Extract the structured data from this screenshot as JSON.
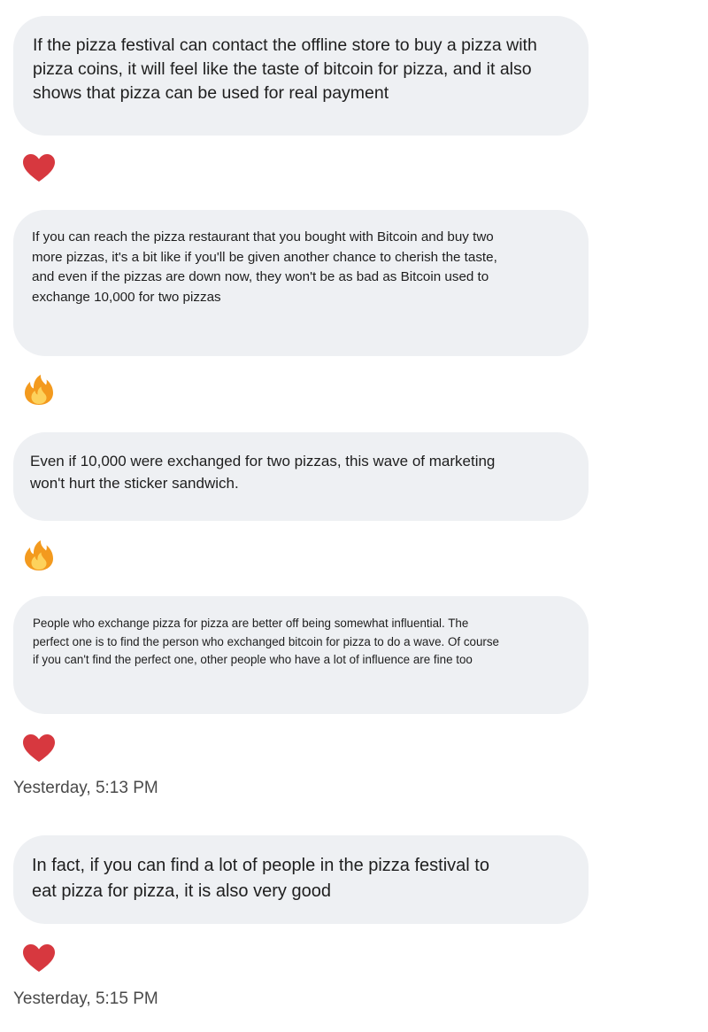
{
  "messages": [
    {
      "text": "If the pizza festival can contact the offline store to buy a pizza with\npizza coins, it will feel like the taste of bitcoin for pizza, and it also\nshows that pizza can be used for real payment",
      "reaction": "heart-icon"
    },
    {
      "text": "If you can reach the pizza restaurant that you bought with Bitcoin and buy two\nmore pizzas, it's a bit like if you'll be given another chance to cherish the taste,\nand even if the pizzas are down now, they won't be as bad as Bitcoin used to\nexchange 10,000 for two pizzas",
      "reaction": "fire-icon"
    },
    {
      "text": "Even if 10,000 were exchanged for two pizzas, this wave of marketing\nwon't hurt the sticker sandwich.",
      "reaction": "fire-icon"
    },
    {
      "text": "People who exchange pizza for pizza are better off being somewhat influential. The\nperfect one is to find the person who exchanged bitcoin for pizza to do a wave. Of course\nif you can't find the perfect one, other people who have a lot of influence are fine too",
      "reaction": "heart-icon",
      "timestamp": "Yesterday, 5:13 PM"
    },
    {
      "text": "In fact, if you can find a lot of people in the pizza festival to\neat pizza for pizza, it is also very good",
      "reaction": "heart-icon",
      "timestamp": "Yesterday, 5:15 PM"
    }
  ],
  "colors": {
    "bubble_background": "#eef0f3",
    "heart": "#d7383f",
    "fire_outer": "#f39a1e",
    "fire_inner": "#fdd25c",
    "timestamp": "#4a4a4a"
  }
}
